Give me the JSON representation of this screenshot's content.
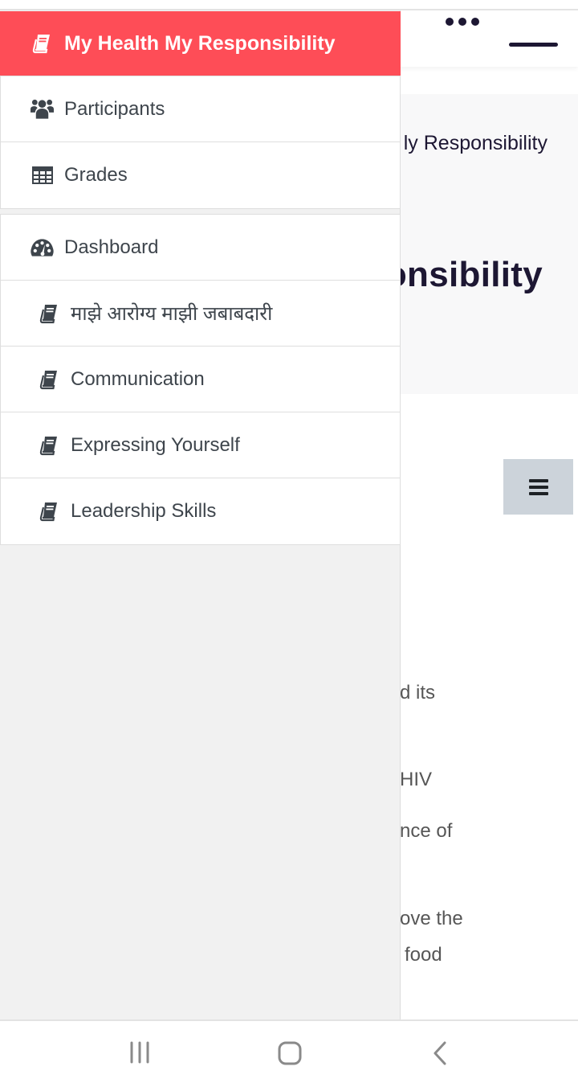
{
  "page": {
    "navbar": {
      "more_icon": "ellipsis-horizontal-icon",
      "toggle_icon": "menu-line-icon"
    },
    "hero": {
      "breadcrumb_fragment": "ly Responsibility",
      "title_fragment": "onsibility"
    },
    "index_toggle_icon": "hamburger-icon",
    "content_fragments": [
      "d its",
      "HIV",
      "nce of",
      "ove the",
      "food"
    ]
  },
  "drawer": {
    "header": {
      "label": "My Health My Responsibility",
      "icon": "book-icon",
      "color": "#fe4d57"
    },
    "group1": [
      {
        "label": "Participants",
        "icon": "users-icon"
      },
      {
        "label": "Grades",
        "icon": "table-icon"
      }
    ],
    "group2": [
      {
        "label": "Dashboard",
        "icon": "tachometer-icon"
      },
      {
        "label": "माझे आरोग्य माझी जबाबदारी",
        "icon": "book-icon"
      },
      {
        "label": "Communication",
        "icon": "book-icon"
      },
      {
        "label": "Expressing Yourself",
        "icon": "book-icon"
      },
      {
        "label": "Leadership Skills",
        "icon": "book-icon"
      }
    ]
  },
  "system_nav": {
    "recents": "recent-apps-icon",
    "home": "home-icon",
    "back": "back-icon"
  }
}
